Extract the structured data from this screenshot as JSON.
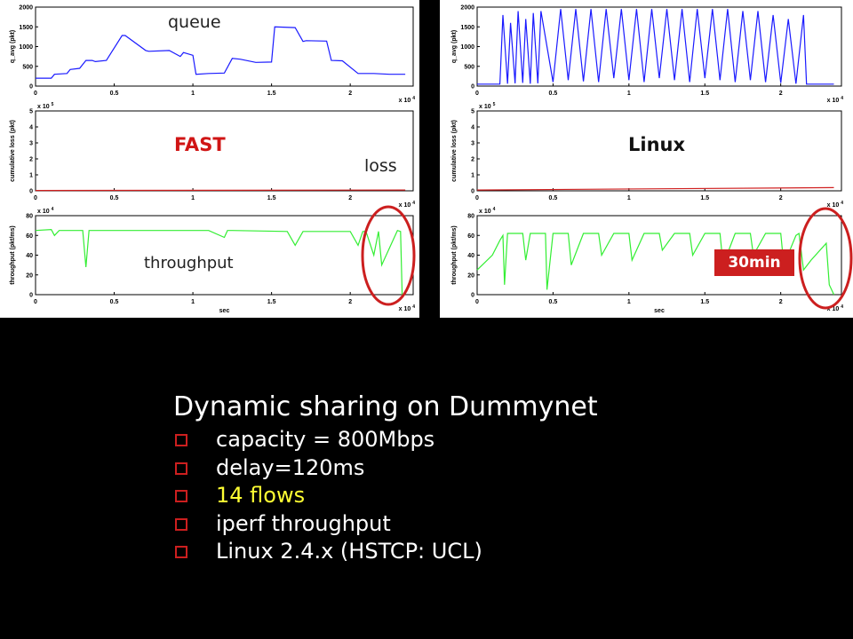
{
  "annotations": {
    "queue_label": "queue",
    "fast_label": "FAST",
    "loss_label": "loss",
    "throughput_label": "throughput",
    "linux_label": "Linux",
    "duration_badge": "30min"
  },
  "colors": {
    "queue": "#1a1aff",
    "loss": "#d02020",
    "throughput": "#33ee33",
    "accent_red": "#cc1f1f",
    "highlight": "#ffff33"
  },
  "slide": {
    "title": "Dynamic sharing on Dummynet",
    "bullets": [
      {
        "text": "capacity = 800Mbps",
        "highlight": false
      },
      {
        "text": "delay=120ms",
        "highlight": false
      },
      {
        "text": "14 flows",
        "highlight": true
      },
      {
        "text": "iperf throughput",
        "highlight": false
      },
      {
        "text": "Linux 2.4.x (HSTCP: UCL)",
        "highlight": false
      }
    ]
  },
  "chart_data": [
    {
      "type": "line",
      "panel": "fast",
      "row": "queue",
      "ylabel": "q_avg (pkt)",
      "xlabel": "",
      "x_multiplier": "x 10^4",
      "xlim": [
        0,
        2.4
      ],
      "ylim": [
        0,
        2000
      ],
      "xticks": [
        "0",
        "0.5",
        "1",
        "1.5",
        "2"
      ],
      "yticks": [
        "0",
        "500",
        "1000",
        "1500",
        "2000"
      ],
      "series": [
        {
          "x": [
            0,
            0.1,
            0.12,
            0.2,
            0.22,
            0.28,
            0.32,
            0.36,
            0.38,
            0.45,
            0.55,
            0.57,
            0.7,
            0.72,
            0.85,
            0.92,
            0.94,
            1.0,
            1.02,
            1.1,
            1.2,
            1.25,
            1.3,
            1.4,
            1.5,
            1.52,
            1.65,
            1.7,
            1.72,
            1.85,
            1.88,
            1.95,
            2.05,
            2.15,
            2.25,
            2.35
          ],
          "y": [
            200,
            200,
            300,
            320,
            420,
            450,
            650,
            650,
            620,
            650,
            1280,
            1280,
            900,
            880,
            900,
            750,
            850,
            780,
            300,
            320,
            330,
            700,
            680,
            600,
            610,
            1500,
            1480,
            1130,
            1150,
            1140,
            650,
            640,
            320,
            320,
            300,
            300
          ]
        }
      ]
    },
    {
      "type": "line",
      "panel": "fast",
      "row": "loss",
      "ylabel": "cumulative loss (pkt)",
      "xlabel": "",
      "x_multiplier": "x 10^4",
      "y_multiplier": "x 10^5",
      "xlim": [
        0,
        2.4
      ],
      "ylim": [
        0,
        5
      ],
      "xticks": [
        "0",
        "0.5",
        "1",
        "1.5",
        "2"
      ],
      "yticks": [
        "0",
        "1",
        "2",
        "3",
        "4",
        "5"
      ],
      "series": [
        {
          "x": [
            0,
            2.35
          ],
          "y": [
            0.02,
            0.05
          ]
        }
      ]
    },
    {
      "type": "line",
      "panel": "fast",
      "row": "throughput",
      "ylabel": "throughput (pkt/ms)",
      "xlabel": "sec",
      "x_multiplier": "x 10^4",
      "y_multiplier": "x 10^4",
      "xlim": [
        0,
        2.4
      ],
      "ylim": [
        0,
        80
      ],
      "xticks": [
        "0",
        "0.5",
        "1",
        "1.5",
        "2"
      ],
      "yticks": [
        "0",
        "20",
        "40",
        "60",
        "80"
      ],
      "series": [
        {
          "x": [
            0,
            0.1,
            0.12,
            0.15,
            0.3,
            0.32,
            0.34,
            0.6,
            1.1,
            1.2,
            1.22,
            1.25,
            1.6,
            1.65,
            1.7,
            2.0,
            2.05,
            2.08,
            2.1,
            2.15,
            2.18,
            2.2,
            2.3,
            2.32,
            2.33,
            2.35
          ],
          "y": [
            65,
            66,
            60,
            65,
            65,
            28,
            65,
            65,
            65,
            58,
            65,
            65,
            64,
            50,
            64,
            64,
            50,
            64,
            64,
            40,
            64,
            30,
            65,
            64,
            0,
            0
          ]
        }
      ]
    },
    {
      "type": "line",
      "panel": "linux",
      "row": "queue",
      "ylabel": "q_avg (pkt)",
      "xlabel": "",
      "x_multiplier": "x 10^4",
      "xlim": [
        0,
        2.4
      ],
      "ylim": [
        0,
        2000
      ],
      "xticks": [
        "0",
        "0.5",
        "1",
        "1.5",
        "2"
      ],
      "yticks": [
        "0",
        "500",
        "1000",
        "1500",
        "2000"
      ],
      "series": [
        {
          "x": [
            0,
            0.15,
            0.17,
            0.2,
            0.22,
            0.25,
            0.27,
            0.3,
            0.32,
            0.35,
            0.37,
            0.4,
            0.42,
            0.5,
            0.55,
            0.6,
            0.65,
            0.7,
            0.75,
            0.8,
            0.85,
            0.9,
            0.95,
            1.0,
            1.05,
            1.1,
            1.15,
            1.2,
            1.25,
            1.3,
            1.35,
            1.4,
            1.45,
            1.5,
            1.55,
            1.6,
            1.65,
            1.7,
            1.75,
            1.8,
            1.85,
            1.9,
            1.95,
            2.0,
            2.05,
            2.1,
            2.15,
            2.17,
            2.2,
            2.25,
            2.35
          ],
          "y": [
            50,
            50,
            1800,
            60,
            1600,
            70,
            1900,
            80,
            1700,
            60,
            1850,
            70,
            1900,
            100,
            1950,
            150,
            1950,
            120,
            1950,
            100,
            1950,
            200,
            1950,
            150,
            1950,
            100,
            1950,
            200,
            1950,
            150,
            1950,
            100,
            1950,
            200,
            1950,
            150,
            1950,
            100,
            1900,
            150,
            1900,
            100,
            1800,
            80,
            1700,
            60,
            1800,
            50,
            50,
            50,
            50
          ]
        }
      ]
    },
    {
      "type": "line",
      "panel": "linux",
      "row": "loss",
      "ylabel": "cumulative loss (pkt)",
      "xlabel": "",
      "x_multiplier": "x 10^4",
      "y_multiplier": "x 10^5",
      "xlim": [
        0,
        2.4
      ],
      "ylim": [
        0,
        5
      ],
      "xticks": [
        "0",
        "0.5",
        "1",
        "1.5",
        "2"
      ],
      "yticks": [
        "0",
        "1",
        "2",
        "3",
        "4",
        "5"
      ],
      "series": [
        {
          "x": [
            0,
            2.35
          ],
          "y": [
            0.05,
            0.2
          ]
        }
      ]
    },
    {
      "type": "line",
      "panel": "linux",
      "row": "throughput",
      "ylabel": "throughput (pkt/ms)",
      "xlabel": "sec",
      "x_multiplier": "x 10^4",
      "y_multiplier": "x 10^4",
      "xlim": [
        0,
        2.4
      ],
      "ylim": [
        0,
        80
      ],
      "xticks": [
        "0",
        "0.5",
        "1",
        "1.5",
        "2"
      ],
      "yticks": [
        "0",
        "20",
        "40",
        "60",
        "80"
      ],
      "series": [
        {
          "x": [
            0,
            0.1,
            0.15,
            0.17,
            0.18,
            0.2,
            0.3,
            0.32,
            0.35,
            0.45,
            0.46,
            0.5,
            0.6,
            0.62,
            0.7,
            0.8,
            0.82,
            0.9,
            1.0,
            1.02,
            1.1,
            1.2,
            1.22,
            1.3,
            1.4,
            1.42,
            1.5,
            1.6,
            1.62,
            1.7,
            1.8,
            1.82,
            1.9,
            2.0,
            2.02,
            2.1,
            2.12,
            2.15,
            2.2,
            2.3,
            2.32,
            2.35
          ],
          "y": [
            25,
            40,
            55,
            60,
            10,
            62,
            62,
            35,
            62,
            62,
            5,
            62,
            62,
            30,
            62,
            62,
            40,
            62,
            62,
            35,
            62,
            62,
            45,
            62,
            62,
            40,
            62,
            62,
            30,
            62,
            62,
            40,
            62,
            62,
            30,
            60,
            62,
            25,
            35,
            52,
            10,
            0
          ]
        }
      ]
    }
  ]
}
